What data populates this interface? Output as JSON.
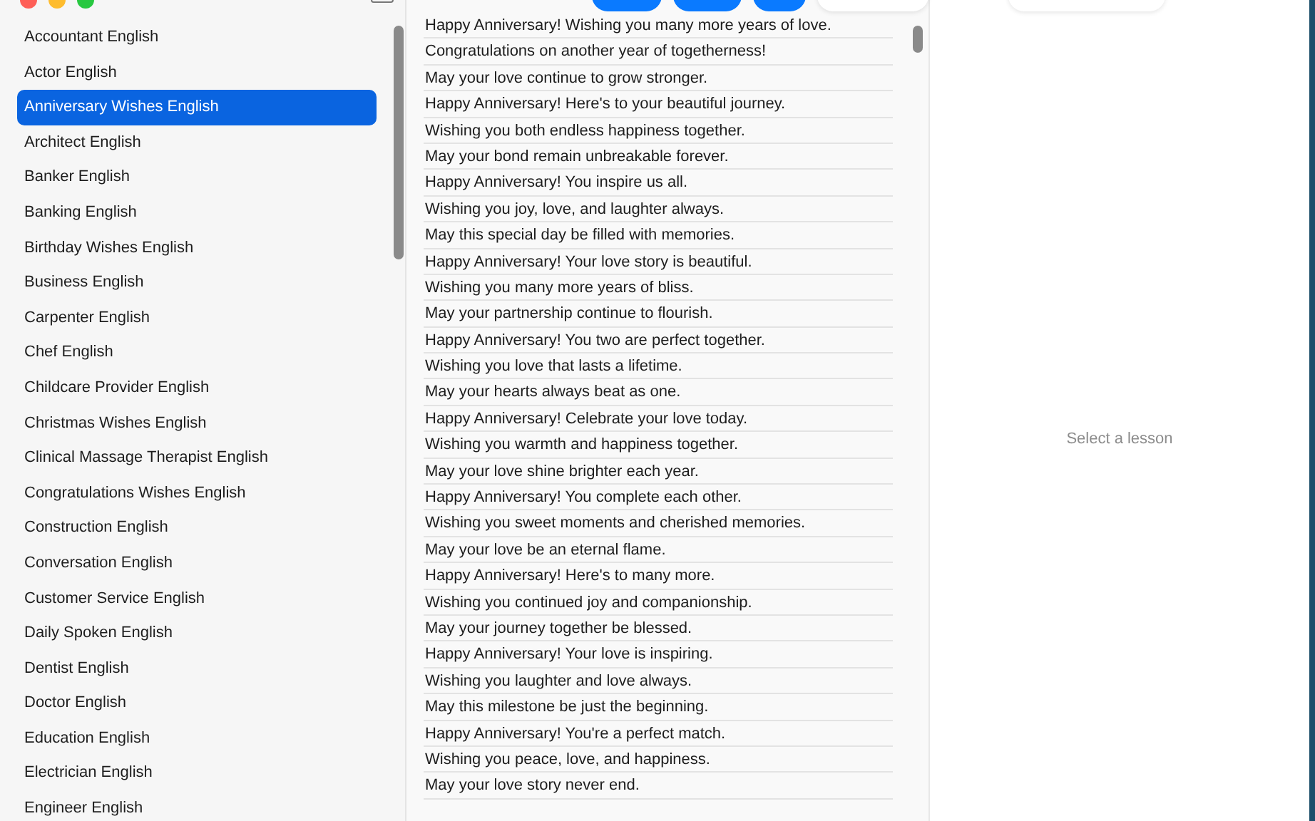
{
  "sidebar": {
    "items": [
      {
        "label": "Accountant English",
        "selected": false
      },
      {
        "label": "Actor English",
        "selected": false
      },
      {
        "label": "Anniversary Wishes English",
        "selected": true
      },
      {
        "label": "Architect English",
        "selected": false
      },
      {
        "label": "Banker English",
        "selected": false
      },
      {
        "label": "Banking English",
        "selected": false
      },
      {
        "label": "Birthday Wishes English",
        "selected": false
      },
      {
        "label": "Business English",
        "selected": false
      },
      {
        "label": "Carpenter English",
        "selected": false
      },
      {
        "label": "Chef English",
        "selected": false
      },
      {
        "label": "Childcare Provider English",
        "selected": false
      },
      {
        "label": "Christmas Wishes English",
        "selected": false
      },
      {
        "label": "Clinical Massage Therapist English",
        "selected": false
      },
      {
        "label": "Congratulations Wishes English",
        "selected": false
      },
      {
        "label": "Construction English",
        "selected": false
      },
      {
        "label": "Conversation English",
        "selected": false
      },
      {
        "label": "Customer Service English",
        "selected": false
      },
      {
        "label": "Daily Spoken English",
        "selected": false
      },
      {
        "label": "Dentist English",
        "selected": false
      },
      {
        "label": "Doctor English",
        "selected": false
      },
      {
        "label": "Education English",
        "selected": false
      },
      {
        "label": "Electrician English",
        "selected": false
      },
      {
        "label": "Engineer English",
        "selected": false
      }
    ]
  },
  "lessons": [
    "Happy Anniversary! Wishing you many more years of love.",
    "Congratulations on another year of togetherness!",
    "May your love continue to grow stronger.",
    "Happy Anniversary! Here's to your beautiful journey.",
    "Wishing you both endless happiness together.",
    "May your bond remain unbreakable forever.",
    "Happy Anniversary! You inspire us all.",
    "Wishing you joy, love, and laughter always.",
    "May this special day be filled with memories.",
    "Happy Anniversary! Your love story is beautiful.",
    "Wishing you many more years of bliss.",
    "May your partnership continue to flourish.",
    "Happy Anniversary! You two are perfect together.",
    "Wishing you love that lasts a lifetime.",
    "May your hearts always beat as one.",
    "Happy Anniversary! Celebrate your love today.",
    "Wishing you warmth and happiness together.",
    "May your love shine brighter each year.",
    "Happy Anniversary! You complete each other.",
    "Wishing you sweet moments and cherished memories.",
    "May your love be an eternal flame.",
    "Happy Anniversary! Here's to many more.",
    "Wishing you continued joy and companionship.",
    "May your journey together be blessed.",
    "Happy Anniversary! Your love is inspiring.",
    "Wishing you laughter and love always.",
    "May this milestone be just the beginning.",
    "Happy Anniversary! You're a perfect match.",
    "Wishing you peace, love, and happiness.",
    "May your love story never end."
  ],
  "detail": {
    "placeholder_text": "Select a lesson"
  }
}
